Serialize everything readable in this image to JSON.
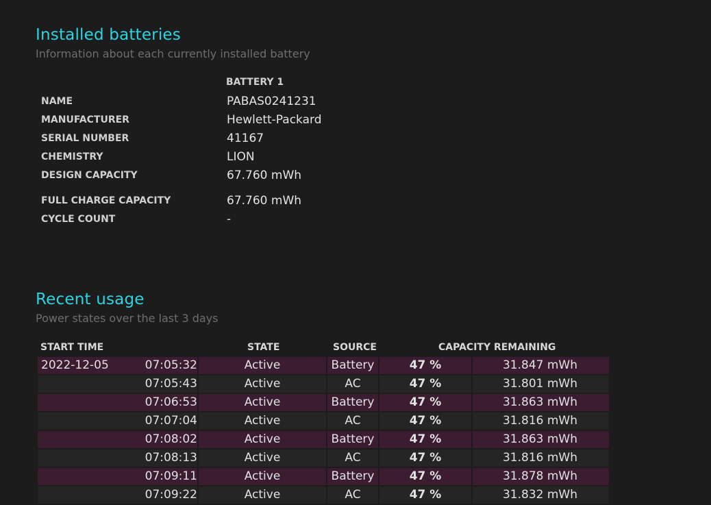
{
  "installed": {
    "title": "Installed batteries",
    "subtitle": "Information about each currently installed battery",
    "battery_header": "BATTERY 1",
    "properties": [
      {
        "label": "NAME",
        "value": "PABAS0241231"
      },
      {
        "label": "MANUFACTURER",
        "value": "Hewlett-Packard"
      },
      {
        "label": "SERIAL NUMBER",
        "value": "41167"
      },
      {
        "label": "CHEMISTRY",
        "value": "LION"
      },
      {
        "label": "DESIGN CAPACITY",
        "value": "67.760 mWh"
      },
      {
        "label": "FULL CHARGE CAPACITY",
        "value": "67.760 mWh"
      },
      {
        "label": "CYCLE COUNT",
        "value": "-"
      }
    ]
  },
  "usage": {
    "title": "Recent usage",
    "subtitle": "Power states over the last 3 days",
    "headers": {
      "start_time": "START TIME",
      "state": "STATE",
      "source": "SOURCE",
      "capacity": "CAPACITY REMAINING"
    },
    "rows": [
      {
        "date": "2022-12-05",
        "time": "07:05:32",
        "state": "Active",
        "source": "Battery",
        "percent": "47 %",
        "mwh": "31.847 mWh"
      },
      {
        "date": "",
        "time": "07:05:43",
        "state": "Active",
        "source": "AC",
        "percent": "47 %",
        "mwh": "31.801 mWh"
      },
      {
        "date": "",
        "time": "07:06:53",
        "state": "Active",
        "source": "Battery",
        "percent": "47 %",
        "mwh": "31.863 mWh"
      },
      {
        "date": "",
        "time": "07:07:04",
        "state": "Active",
        "source": "AC",
        "percent": "47 %",
        "mwh": "31.816 mWh"
      },
      {
        "date": "",
        "time": "07:08:02",
        "state": "Active",
        "source": "Battery",
        "percent": "47 %",
        "mwh": "31.863 mWh"
      },
      {
        "date": "",
        "time": "07:08:13",
        "state": "Active",
        "source": "AC",
        "percent": "47 %",
        "mwh": "31.816 mWh"
      },
      {
        "date": "",
        "time": "07:09:11",
        "state": "Active",
        "source": "Battery",
        "percent": "47 %",
        "mwh": "31.878 mWh"
      },
      {
        "date": "",
        "time": "07:09:22",
        "state": "Active",
        "source": "AC",
        "percent": "47 %",
        "mwh": "31.832 mWh"
      }
    ]
  },
  "colors": {
    "heading": "#2ad4e0",
    "battery_row": "#3b1c30",
    "ac_row": "#252525",
    "background": "#1c1c1c"
  }
}
